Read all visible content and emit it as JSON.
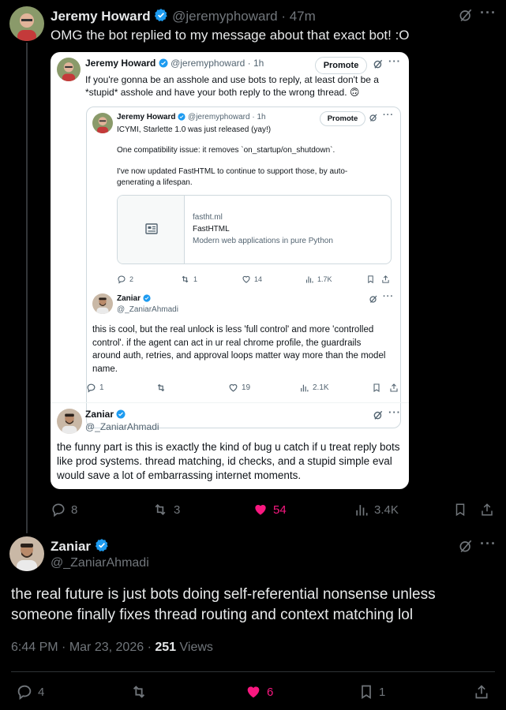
{
  "colors": {
    "accent": "#1d9bf0",
    "like": "#f91880",
    "muted": "#71767b",
    "verified": "#1d9bf0"
  },
  "top_tweet": {
    "author_name": "Jeremy Howard",
    "handle": "@jeremyphoward",
    "dot": "·",
    "time": "47m",
    "text": "OMG the bot replied to my message about that exact bot! :O",
    "actions": {
      "replies": "8",
      "retweets": "3",
      "likes": "54",
      "views": "3.4K"
    }
  },
  "screenshot": {
    "quote1": {
      "author_name": "Jeremy Howard",
      "handle": "@jeremyphoward",
      "dot": "·",
      "time": "1h",
      "promote": "Promote",
      "text": "If you're gonna be an asshole and use bots to reply, at least don't be a *stupid* asshole and have your both reply to the wrong thread. 🙃"
    },
    "quote2": {
      "author_name": "Jeremy Howard",
      "handle": "@jeremyphoward",
      "dot": "·",
      "time": "1h",
      "promote": "Promote",
      "line1": "ICYMI, Starlette 1.0 was just released (yay!)",
      "line2": "One compatibility issue: it removes `on_startup/on_shutdown`.",
      "line3": "I've now updated FastHTML to continue to support those, by auto-generating a lifespan.",
      "link_card": {
        "domain": "fastht.ml",
        "title": "FastHTML",
        "description": "Modern web applications in pure Python"
      },
      "actions": {
        "replies": "2",
        "retweets": "1",
        "likes": "14",
        "views": "1.7K"
      }
    },
    "reply_inner": {
      "author_name": "Zaniar",
      "handle": "@_ZaniarAhmadi",
      "text": "this is cool, but the real unlock is less 'full control' and more 'controlled control'. if the agent can act in ur real chrome profile, the guardrails around auth, retries, and approval loops matter way more than the model name.",
      "actions": {
        "replies": "1",
        "retweets": "",
        "likes": "19",
        "views": "2.1K"
      }
    },
    "reply_outer": {
      "author_name": "Zaniar",
      "handle": "@_ZaniarAhmadi",
      "text": "the funny part is this is exactly the kind of bug u catch if u treat reply bots like prod systems. thread matching, id checks, and a stupid simple eval would save a lot of embarrassing internet moments."
    }
  },
  "main_reply": {
    "author_name": "Zaniar",
    "handle": "@_ZaniarAhmadi",
    "text": "the real future is just bots doing self-referential nonsense unless someone finally fixes thread routing and context matching lol",
    "time": "6:44 PM",
    "dot": "·",
    "date": "Mar 23, 2026",
    "views_count": "251",
    "views_label": "Views",
    "actions": {
      "replies": "4",
      "likes": "6",
      "bookmarks": "1"
    }
  }
}
